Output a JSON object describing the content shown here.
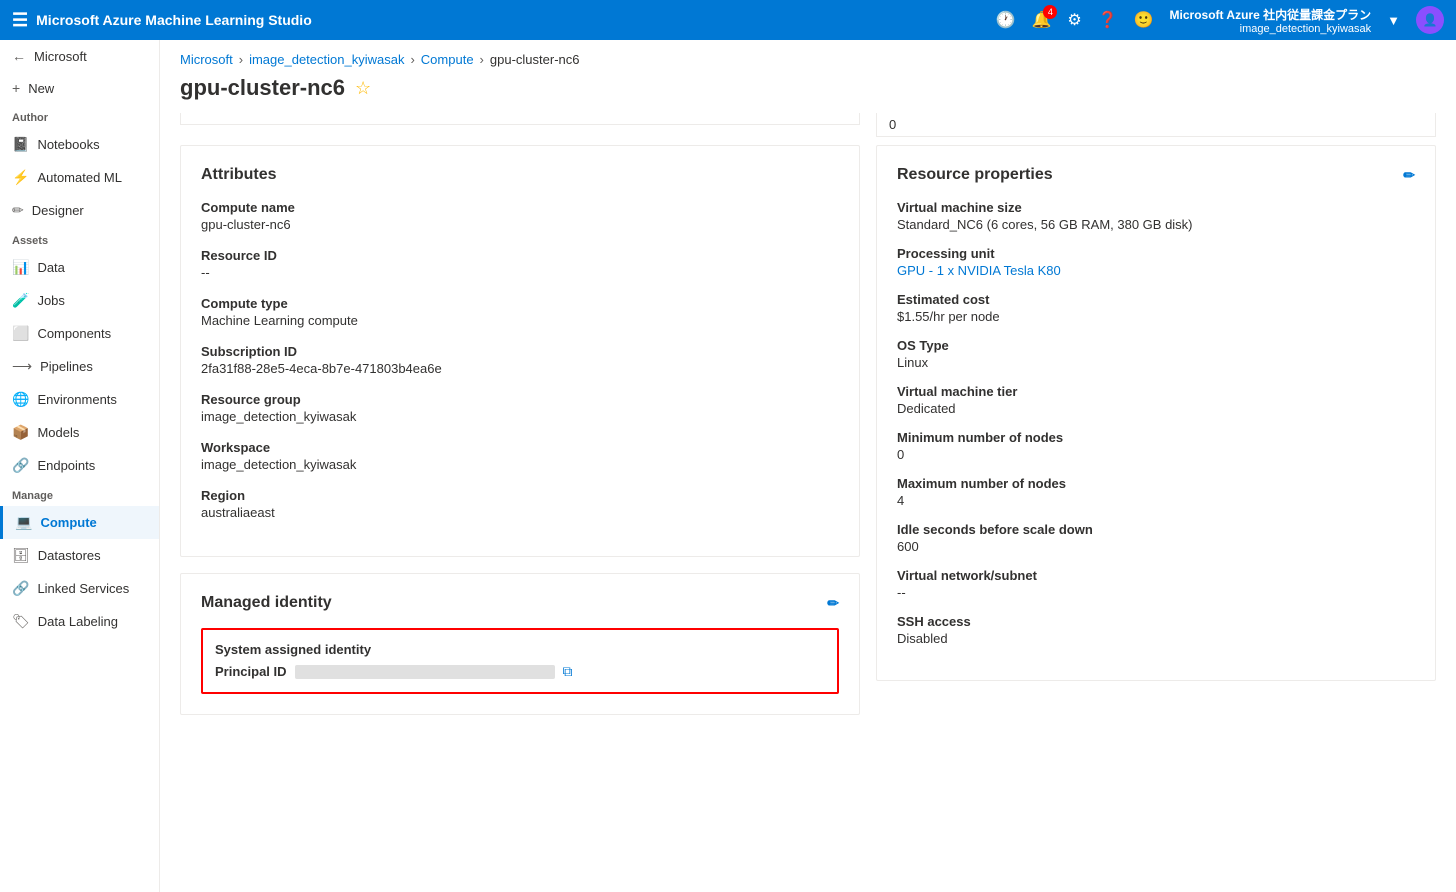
{
  "app": {
    "title": "Microsoft Azure Machine Learning Studio"
  },
  "topbar": {
    "title": "Microsoft Azure Machine Learning Studio",
    "notification_count": "4",
    "subscription": "Microsoft Azure 社内従量課金プラン",
    "workspace": "image_detection_kyiwasak"
  },
  "breadcrumb": {
    "items": [
      "Microsoft",
      "image_detection_kyiwasak",
      "Compute",
      "gpu-cluster-nc6"
    ]
  },
  "page": {
    "title": "gpu-cluster-nc6"
  },
  "sidebar": {
    "back_label": "Microsoft",
    "new_label": "New",
    "author_section": "Author",
    "notebooks_label": "Notebooks",
    "automated_ml_label": "Automated ML",
    "designer_label": "Designer",
    "assets_section": "Assets",
    "data_label": "Data",
    "jobs_label": "Jobs",
    "components_label": "Components",
    "pipelines_label": "Pipelines",
    "environments_label": "Environments",
    "models_label": "Models",
    "endpoints_label": "Endpoints",
    "manage_section": "Manage",
    "compute_label": "Compute",
    "datastores_label": "Datastores",
    "linked_services_label": "Linked Services",
    "data_labeling_label": "Data Labeling"
  },
  "attributes_card": {
    "title": "Attributes",
    "compute_name_label": "Compute name",
    "compute_name_value": "gpu-cluster-nc6",
    "resource_id_label": "Resource ID",
    "resource_id_value": "--",
    "compute_type_label": "Compute type",
    "compute_type_value": "Machine Learning compute",
    "subscription_id_label": "Subscription ID",
    "subscription_id_value": "2fa31f88-28e5-4eca-8b7e-471803b4ea6e",
    "resource_group_label": "Resource group",
    "resource_group_value": "image_detection_kyiwasak",
    "workspace_label": "Workspace",
    "workspace_value": "image_detection_kyiwasak",
    "region_label": "Region",
    "region_value": "australiaeast"
  },
  "resource_properties": {
    "title": "Resource properties",
    "vm_size_label": "Virtual machine size",
    "vm_size_value": "Standard_NC6 (6 cores, 56 GB RAM, 380 GB disk)",
    "processing_unit_label": "Processing unit",
    "processing_unit_value": "GPU - 1 x NVIDIA Tesla K80",
    "estimated_cost_label": "Estimated cost",
    "estimated_cost_value": "$1.55/hr per node",
    "os_type_label": "OS Type",
    "os_type_value": "Linux",
    "vm_tier_label": "Virtual machine tier",
    "vm_tier_value": "Dedicated",
    "min_nodes_label": "Minimum number of nodes",
    "min_nodes_value": "0",
    "max_nodes_label": "Maximum number of nodes",
    "max_nodes_value": "4",
    "idle_seconds_label": "Idle seconds before scale down",
    "idle_seconds_value": "600",
    "vnet_label": "Virtual network/subnet",
    "vnet_value": "--",
    "ssh_access_label": "SSH access",
    "ssh_access_value": "Disabled"
  },
  "managed_identity": {
    "title": "Managed identity",
    "system_assigned_label": "System assigned identity",
    "principal_id_label": "Principal ID"
  },
  "top_partial": {
    "right_value": "0"
  }
}
